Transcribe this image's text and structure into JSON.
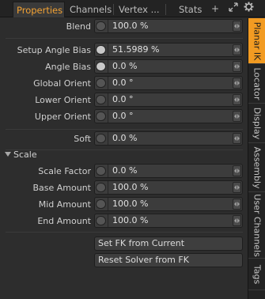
{
  "tabs": [
    {
      "label": "Properties",
      "active": true
    },
    {
      "label": "Channels",
      "active": false
    },
    {
      "label": "Vertex ...",
      "active": false
    },
    {
      "label": "Stats",
      "active": false
    }
  ],
  "toolbar": {
    "add_label": "+",
    "expand_icon": "expand-icon",
    "settings_icon": "gear-icon"
  },
  "properties": {
    "blend": {
      "label": "Blend",
      "value": "100.0 %"
    },
    "setup_angle_bias": {
      "label": "Setup Angle Bias",
      "value": "51.5989 %"
    },
    "angle_bias": {
      "label": "Angle Bias",
      "value": "0.0 %"
    },
    "global_orient": {
      "label": "Global Orient",
      "value": "0.0 °"
    },
    "lower_orient": {
      "label": "Lower Orient",
      "value": "0.0 °"
    },
    "upper_orient": {
      "label": "Upper Orient",
      "value": "0.0 °"
    },
    "soft": {
      "label": "Soft",
      "value": "0.0 %"
    }
  },
  "scale_section": {
    "title": "Scale",
    "scale_factor": {
      "label": "Scale Factor",
      "value": "0.0 %"
    },
    "base_amount": {
      "label": "Base Amount",
      "value": "100.0 %"
    },
    "mid_amount": {
      "label": "Mid Amount",
      "value": "100.0 %"
    },
    "end_amount": {
      "label": "End Amount",
      "value": "100.0 %"
    }
  },
  "buttons": {
    "set_fk": "Set FK from Current",
    "reset_solver": "Reset Solver from FK"
  },
  "side_tabs": [
    {
      "label": "Planar IK",
      "active": true
    },
    {
      "label": "Locator",
      "active": false
    },
    {
      "label": "Display",
      "active": false
    },
    {
      "label": "Assembly",
      "active": false
    },
    {
      "label": "User Channels",
      "active": false
    },
    {
      "label": "Tags",
      "active": false
    }
  ],
  "colors": {
    "accent": "#f29b22",
    "background": "#2d2d2d",
    "field": "#3c3c3c"
  }
}
